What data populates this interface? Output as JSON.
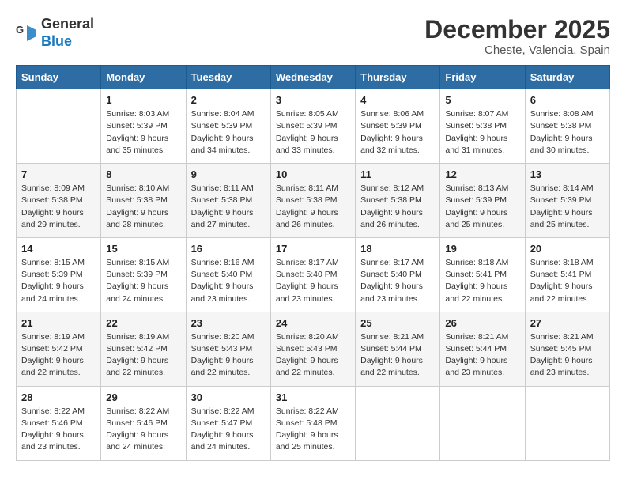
{
  "logo": {
    "line1": "General",
    "line2": "Blue"
  },
  "title": "December 2025",
  "location": "Cheste, Valencia, Spain",
  "days_of_week": [
    "Sunday",
    "Monday",
    "Tuesday",
    "Wednesday",
    "Thursday",
    "Friday",
    "Saturday"
  ],
  "weeks": [
    [
      {
        "day": "",
        "sunrise": "",
        "sunset": "",
        "daylight": ""
      },
      {
        "day": "1",
        "sunrise": "Sunrise: 8:03 AM",
        "sunset": "Sunset: 5:39 PM",
        "daylight": "Daylight: 9 hours and 35 minutes."
      },
      {
        "day": "2",
        "sunrise": "Sunrise: 8:04 AM",
        "sunset": "Sunset: 5:39 PM",
        "daylight": "Daylight: 9 hours and 34 minutes."
      },
      {
        "day": "3",
        "sunrise": "Sunrise: 8:05 AM",
        "sunset": "Sunset: 5:39 PM",
        "daylight": "Daylight: 9 hours and 33 minutes."
      },
      {
        "day": "4",
        "sunrise": "Sunrise: 8:06 AM",
        "sunset": "Sunset: 5:39 PM",
        "daylight": "Daylight: 9 hours and 32 minutes."
      },
      {
        "day": "5",
        "sunrise": "Sunrise: 8:07 AM",
        "sunset": "Sunset: 5:38 PM",
        "daylight": "Daylight: 9 hours and 31 minutes."
      },
      {
        "day": "6",
        "sunrise": "Sunrise: 8:08 AM",
        "sunset": "Sunset: 5:38 PM",
        "daylight": "Daylight: 9 hours and 30 minutes."
      }
    ],
    [
      {
        "day": "7",
        "sunrise": "Sunrise: 8:09 AM",
        "sunset": "Sunset: 5:38 PM",
        "daylight": "Daylight: 9 hours and 29 minutes."
      },
      {
        "day": "8",
        "sunrise": "Sunrise: 8:10 AM",
        "sunset": "Sunset: 5:38 PM",
        "daylight": "Daylight: 9 hours and 28 minutes."
      },
      {
        "day": "9",
        "sunrise": "Sunrise: 8:11 AM",
        "sunset": "Sunset: 5:38 PM",
        "daylight": "Daylight: 9 hours and 27 minutes."
      },
      {
        "day": "10",
        "sunrise": "Sunrise: 8:11 AM",
        "sunset": "Sunset: 5:38 PM",
        "daylight": "Daylight: 9 hours and 26 minutes."
      },
      {
        "day": "11",
        "sunrise": "Sunrise: 8:12 AM",
        "sunset": "Sunset: 5:38 PM",
        "daylight": "Daylight: 9 hours and 26 minutes."
      },
      {
        "day": "12",
        "sunrise": "Sunrise: 8:13 AM",
        "sunset": "Sunset: 5:39 PM",
        "daylight": "Daylight: 9 hours and 25 minutes."
      },
      {
        "day": "13",
        "sunrise": "Sunrise: 8:14 AM",
        "sunset": "Sunset: 5:39 PM",
        "daylight": "Daylight: 9 hours and 25 minutes."
      }
    ],
    [
      {
        "day": "14",
        "sunrise": "Sunrise: 8:15 AM",
        "sunset": "Sunset: 5:39 PM",
        "daylight": "Daylight: 9 hours and 24 minutes."
      },
      {
        "day": "15",
        "sunrise": "Sunrise: 8:15 AM",
        "sunset": "Sunset: 5:39 PM",
        "daylight": "Daylight: 9 hours and 24 minutes."
      },
      {
        "day": "16",
        "sunrise": "Sunrise: 8:16 AM",
        "sunset": "Sunset: 5:40 PM",
        "daylight": "Daylight: 9 hours and 23 minutes."
      },
      {
        "day": "17",
        "sunrise": "Sunrise: 8:17 AM",
        "sunset": "Sunset: 5:40 PM",
        "daylight": "Daylight: 9 hours and 23 minutes."
      },
      {
        "day": "18",
        "sunrise": "Sunrise: 8:17 AM",
        "sunset": "Sunset: 5:40 PM",
        "daylight": "Daylight: 9 hours and 23 minutes."
      },
      {
        "day": "19",
        "sunrise": "Sunrise: 8:18 AM",
        "sunset": "Sunset: 5:41 PM",
        "daylight": "Daylight: 9 hours and 22 minutes."
      },
      {
        "day": "20",
        "sunrise": "Sunrise: 8:18 AM",
        "sunset": "Sunset: 5:41 PM",
        "daylight": "Daylight: 9 hours and 22 minutes."
      }
    ],
    [
      {
        "day": "21",
        "sunrise": "Sunrise: 8:19 AM",
        "sunset": "Sunset: 5:42 PM",
        "daylight": "Daylight: 9 hours and 22 minutes."
      },
      {
        "day": "22",
        "sunrise": "Sunrise: 8:19 AM",
        "sunset": "Sunset: 5:42 PM",
        "daylight": "Daylight: 9 hours and 22 minutes."
      },
      {
        "day": "23",
        "sunrise": "Sunrise: 8:20 AM",
        "sunset": "Sunset: 5:43 PM",
        "daylight": "Daylight: 9 hours and 22 minutes."
      },
      {
        "day": "24",
        "sunrise": "Sunrise: 8:20 AM",
        "sunset": "Sunset: 5:43 PM",
        "daylight": "Daylight: 9 hours and 22 minutes."
      },
      {
        "day": "25",
        "sunrise": "Sunrise: 8:21 AM",
        "sunset": "Sunset: 5:44 PM",
        "daylight": "Daylight: 9 hours and 22 minutes."
      },
      {
        "day": "26",
        "sunrise": "Sunrise: 8:21 AM",
        "sunset": "Sunset: 5:44 PM",
        "daylight": "Daylight: 9 hours and 23 minutes."
      },
      {
        "day": "27",
        "sunrise": "Sunrise: 8:21 AM",
        "sunset": "Sunset: 5:45 PM",
        "daylight": "Daylight: 9 hours and 23 minutes."
      }
    ],
    [
      {
        "day": "28",
        "sunrise": "Sunrise: 8:22 AM",
        "sunset": "Sunset: 5:46 PM",
        "daylight": "Daylight: 9 hours and 23 minutes."
      },
      {
        "day": "29",
        "sunrise": "Sunrise: 8:22 AM",
        "sunset": "Sunset: 5:46 PM",
        "daylight": "Daylight: 9 hours and 24 minutes."
      },
      {
        "day": "30",
        "sunrise": "Sunrise: 8:22 AM",
        "sunset": "Sunset: 5:47 PM",
        "daylight": "Daylight: 9 hours and 24 minutes."
      },
      {
        "day": "31",
        "sunrise": "Sunrise: 8:22 AM",
        "sunset": "Sunset: 5:48 PM",
        "daylight": "Daylight: 9 hours and 25 minutes."
      },
      {
        "day": "",
        "sunrise": "",
        "sunset": "",
        "daylight": ""
      },
      {
        "day": "",
        "sunrise": "",
        "sunset": "",
        "daylight": ""
      },
      {
        "day": "",
        "sunrise": "",
        "sunset": "",
        "daylight": ""
      }
    ]
  ]
}
